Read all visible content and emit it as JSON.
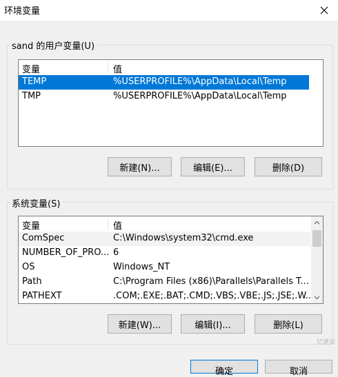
{
  "window": {
    "title": "环境变量"
  },
  "user_vars": {
    "group_label": "sand 的用户变量(U)",
    "columns": [
      "变量",
      "值"
    ],
    "rows": [
      {
        "name": "TEMP",
        "value": "%USERPROFILE%\\AppData\\Local\\Temp",
        "selected": true
      },
      {
        "name": "TMP",
        "value": "%USERPROFILE%\\AppData\\Local\\Temp",
        "selected": false
      }
    ],
    "buttons": {
      "new": "新建(N)...",
      "edit": "编辑(E)...",
      "delete": "删除(D)"
    }
  },
  "system_vars": {
    "group_label": "系统变量(S)",
    "columns": [
      "变量",
      "值"
    ],
    "rows": [
      {
        "name": "ComSpec",
        "value": "C:\\Windows\\system32\\cmd.exe"
      },
      {
        "name": "NUMBER_OF_PRO...",
        "value": "6"
      },
      {
        "name": "OS",
        "value": "Windows_NT"
      },
      {
        "name": "Path",
        "value": "C:\\Program Files (x86)\\Parallels\\Parallels T..."
      },
      {
        "name": "PATHEXT",
        "value": ".COM;.EXE;.BAT;.CMD;.VBS;.VBE;.JS;.JSE;.W..."
      }
    ],
    "buttons": {
      "new": "新建(W)...",
      "edit": "编辑(I)...",
      "delete": "删除(L)"
    }
  },
  "footer": {
    "ok": "确定",
    "cancel": "取消"
  },
  "watermark": "亿速云",
  "colors": {
    "selection": "#0078d7",
    "primary_border": "#0078d7"
  }
}
